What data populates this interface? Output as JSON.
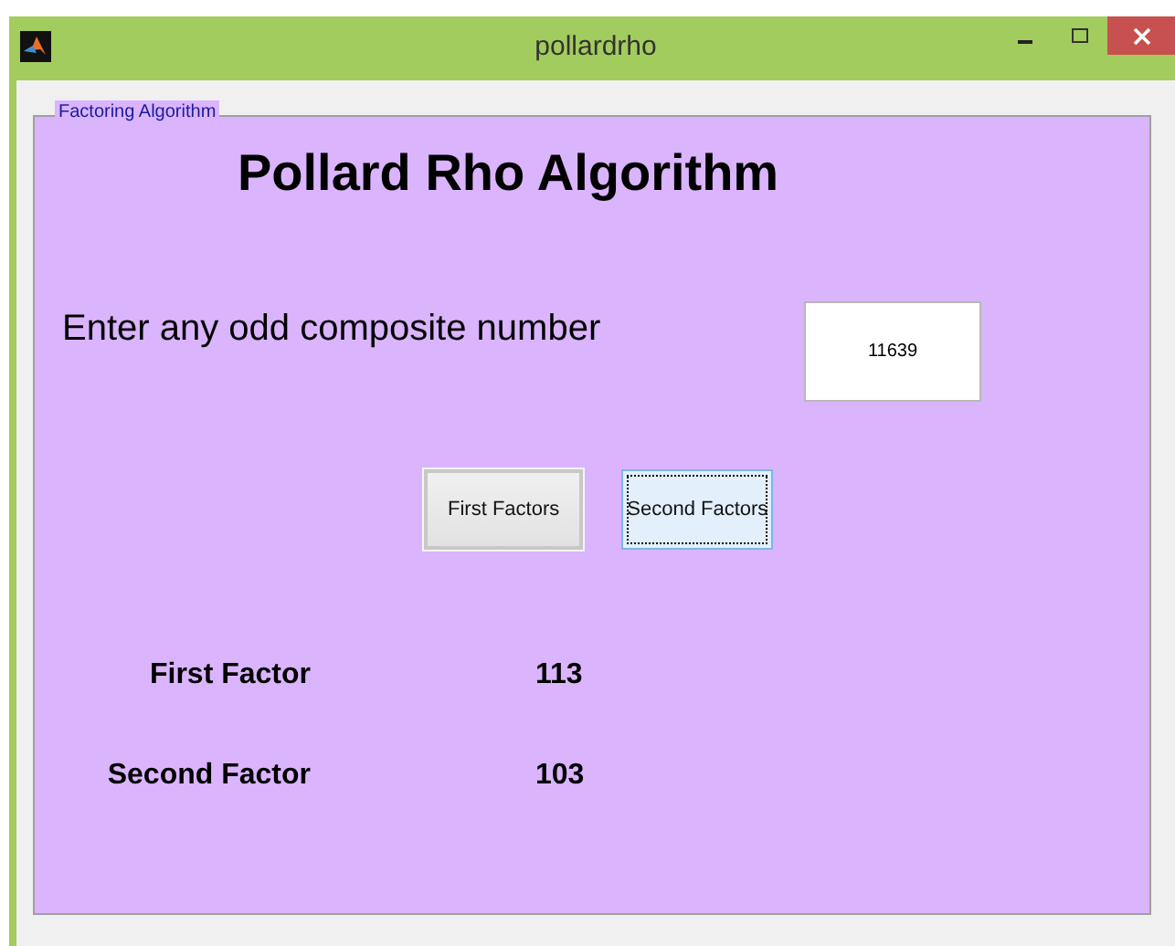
{
  "window": {
    "title": "pollardrho"
  },
  "panel": {
    "title": "Factoring Algorithm",
    "heading": "Pollard Rho Algorithm",
    "prompt": {
      "label": "Enter any odd composite number",
      "value": "11639"
    },
    "buttons": [
      {
        "label": "First Factors",
        "focused": false
      },
      {
        "label": "Second Factors",
        "focused": true
      }
    ],
    "results": [
      {
        "label": "First Factor",
        "value": "113"
      },
      {
        "label": "Second Factor",
        "value": "103"
      }
    ]
  }
}
